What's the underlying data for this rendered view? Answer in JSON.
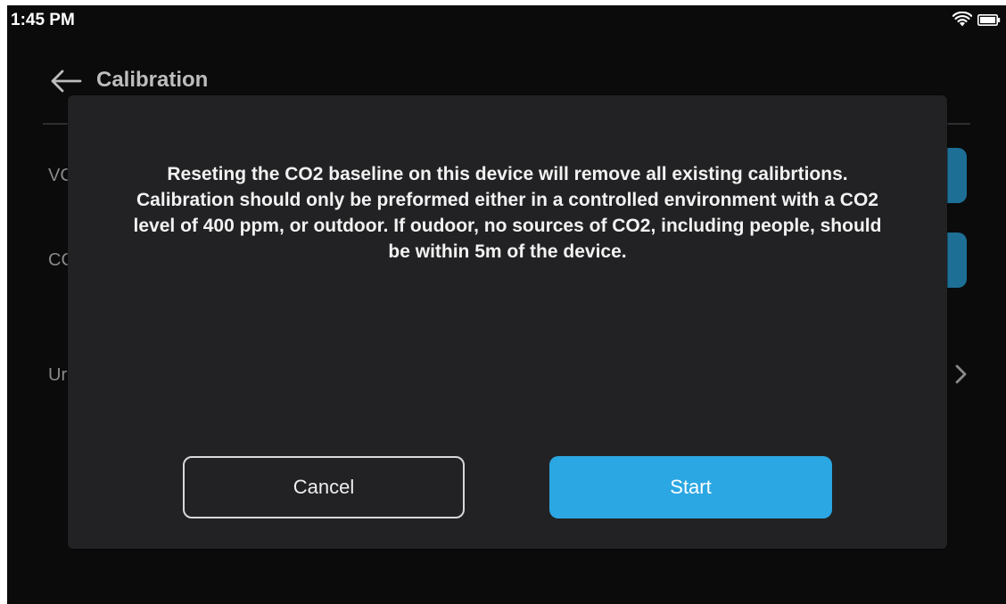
{
  "status_bar": {
    "time": "1:45 PM",
    "wifi_icon": "wifi-icon",
    "battery_icon": "battery-icon"
  },
  "app_bar": {
    "back_icon": "arrow-left-icon",
    "title": "Calibration"
  },
  "background_rows": [
    {
      "label": "VC",
      "control": "button"
    },
    {
      "label": "CC",
      "control": "button"
    },
    {
      "label": "Ur",
      "control": "chevron-right-icon"
    }
  ],
  "dialog": {
    "message": "Reseting the CO2 baseline on this device will remove all existing calibrtions. Calibration should only be preformed either in a controlled environment with a CO2 level of 400 ppm, or outdoor. If oudoor, no sources of CO2, including people, should be within 5m of the device.",
    "cancel_label": "Cancel",
    "start_label": "Start"
  },
  "colors": {
    "background": "#0b0b0c",
    "dialog": "#222224",
    "accent": "#2ba7e3",
    "row_button": "#1d6f95"
  }
}
